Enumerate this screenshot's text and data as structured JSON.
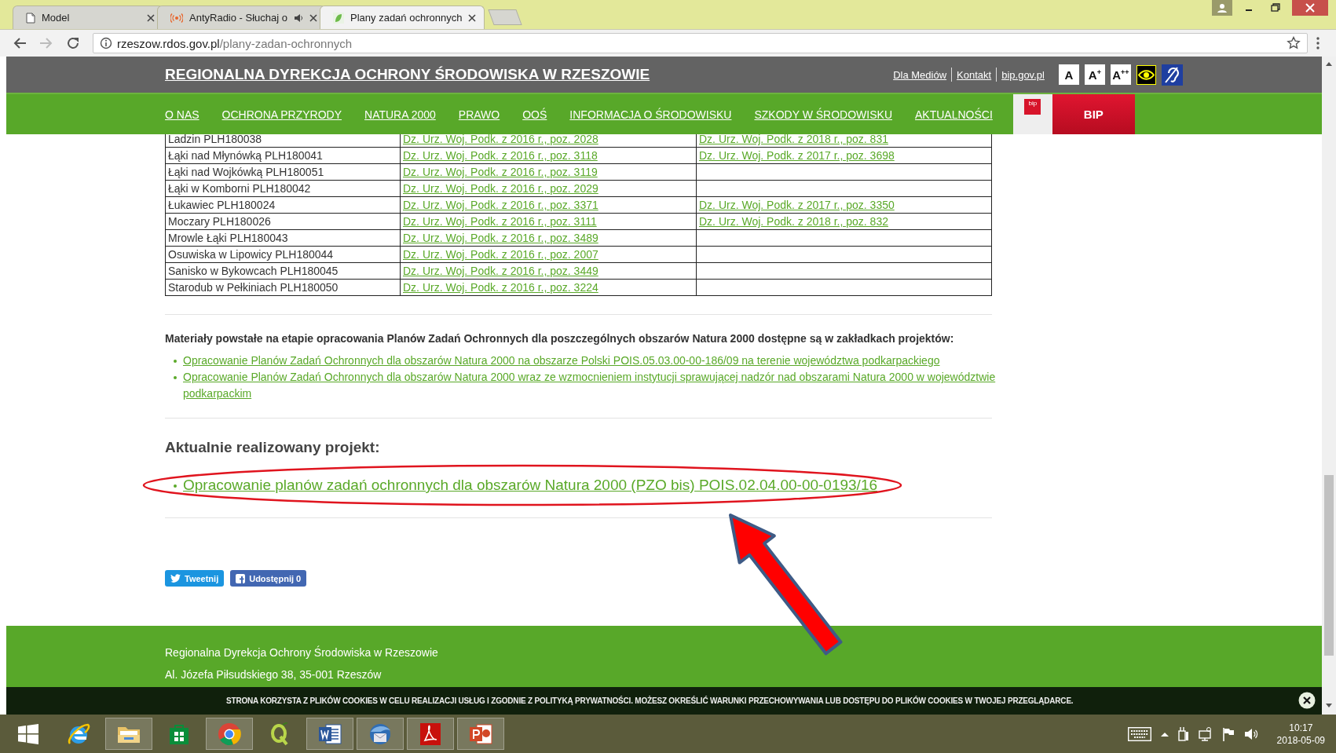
{
  "browser": {
    "tabs": [
      {
        "title": "Model",
        "kind": "document",
        "audio": false,
        "selected": false
      },
      {
        "title": "AntyRadio - Słuchaj o",
        "kind": "radio",
        "audio": true,
        "selected": false
      },
      {
        "title": "Plany zadań ochronnych",
        "kind": "leaf",
        "audio": false,
        "selected": true
      }
    ],
    "address": {
      "host": "rzeszow.rdos.gov.pl",
      "path": "/plany-zadan-ochronnych"
    }
  },
  "site": {
    "title": "REGIONALNA DYREKCJA OCHRONY ŚRODOWISKA W RZESZOWIE",
    "top_links": [
      "Dla Mediów",
      "Kontakt",
      "bip.gov.pl"
    ],
    "font_buttons": [
      "A",
      "A$^{+}$",
      "A$^{++}$"
    ],
    "nav": [
      "O NAS",
      "OCHRONA PRZYRODY",
      "NATURA 2000",
      "PRAWO",
      "OOŚ",
      "INFORMACJA O ŚRODOWISKU",
      "SZKODY W ŚRODOWISKU",
      "AKTUALNOŚCI"
    ],
    "bip_logo": "bip",
    "bip_button": "BIP"
  },
  "table": {
    "rows": [
      {
        "name": "Ladzin PLH180038",
        "act_2016": "Dz. Urz. Woj. Podk. z 2016 r., poz. 2028",
        "act_later": "Dz. Urz. Woj. Podk. z 2018 r., poz. 831"
      },
      {
        "name": "Łąki nad Młynówką PLH180041",
        "act_2016": "Dz. Urz. Woj. Podk. z 2016 r., poz. 3118",
        "act_later": "Dz. Urz. Woj. Podk. z 2017 r., poz. 3698"
      },
      {
        "name": "Łąki nad Wojkówką PLH180051",
        "act_2016": "Dz. Urz. Woj. Podk. z 2016 r., poz. 3119"
      },
      {
        "name": "Łąki w Komborni PLH180042",
        "act_2016": "Dz. Urz. Woj. Podk. z 2016 r., poz. 2029"
      },
      {
        "name": "Łukawiec PLH180024",
        "act_2016": "Dz. Urz. Woj. Podk. z 2016 r., poz. 3371",
        "act_later": "Dz. Urz. Woj. Podk. z 2017 r., poz. 3350"
      },
      {
        "name": "Moczary PLH180026",
        "act_2016": "Dz. Urz. Woj. Podk. z 2016 r., poz. 3111",
        "act_later": "Dz. Urz. Woj. Podk. z 2018 r., poz. 832"
      },
      {
        "name": "Mrowle Łąki PLH180043",
        "act_2016": "Dz. Urz. Woj. Podk. z 2016 r., poz. 3489"
      },
      {
        "name": "Osuwiska w Lipowicy PLH180044",
        "act_2016": "Dz. Urz. Woj. Podk. z 2016 r., poz. 2007"
      },
      {
        "name": "Sanisko w Bykowcach PLH180045",
        "act_2016": "Dz. Urz. Woj. Podk. z 2016 r., poz. 3449"
      },
      {
        "name": "Starodub w Pełkiniach PLH180050",
        "act_2016": "Dz. Urz. Woj. Podk. z 2016 r., poz. 3224"
      }
    ]
  },
  "materials": {
    "intro": "Materiały powstałe na etapie opracowania Planów Zadań Ochronnych dla poszczególnych obszarów Natura 2000 dostępne są w zakładkach projektów:",
    "links": [
      "Opracowanie Planów Zadań Ochronnych dla obszarów Natura 2000 na obszarze Polski POIS.05.03.00-00-186/09 na terenie województwa podkarpackiego",
      "Opracowanie Planów Zadań Ochronnych dla obszarów Natura 2000 wraz ze wzmocnieniem instytucji sprawującej nadzór nad obszarami Natura 2000 w województwie podkarpackim"
    ]
  },
  "current": {
    "heading": "Aktualnie realizowany projekt:",
    "links": [
      "Opracowanie planów zadań ochronnych dla obszarów Natura 2000 (PZO bis) POIS.02.04.00-00-0193/16"
    ]
  },
  "share": [
    {
      "kind": "twitter",
      "label": "Tweetnij"
    },
    {
      "kind": "facebook",
      "label": "Udostępnij 0"
    }
  ],
  "footer": {
    "lines": [
      "Regionalna Dyrekcja Ochrony Środowiska w Rzeszowie",
      "Al. Józefa Piłsudskiego 38, 35-001 Rzeszów"
    ]
  },
  "cookie_notice": "STRONA KORZYSTA Z PLIKÓW COOKIES W CELU REALIZACJI USŁUG I ZGODNIE Z POLITYKĄ PRYWATNOŚCI. MOŻESZ OKREŚLIĆ WARUNKI PRZECHOWYWANIA LUB DOSTĘPU DO PLIKÓW COOKIES W TWOJEJ PRZEGLĄDARCE.",
  "taskbar": {
    "apps": [
      {
        "kind": "start",
        "running": false
      },
      {
        "kind": "ie",
        "running": false
      },
      {
        "kind": "explorer",
        "running": true
      },
      {
        "kind": "store",
        "running": false
      },
      {
        "kind": "chrome",
        "running": true
      },
      {
        "kind": "qgis",
        "running": false
      },
      {
        "kind": "word",
        "running": true
      },
      {
        "kind": "thunderbird",
        "running": true
      },
      {
        "kind": "acrobat",
        "running": true
      },
      {
        "kind": "powerpoint",
        "running": true
      }
    ],
    "time": "10:17",
    "date": "2018-05-09"
  }
}
